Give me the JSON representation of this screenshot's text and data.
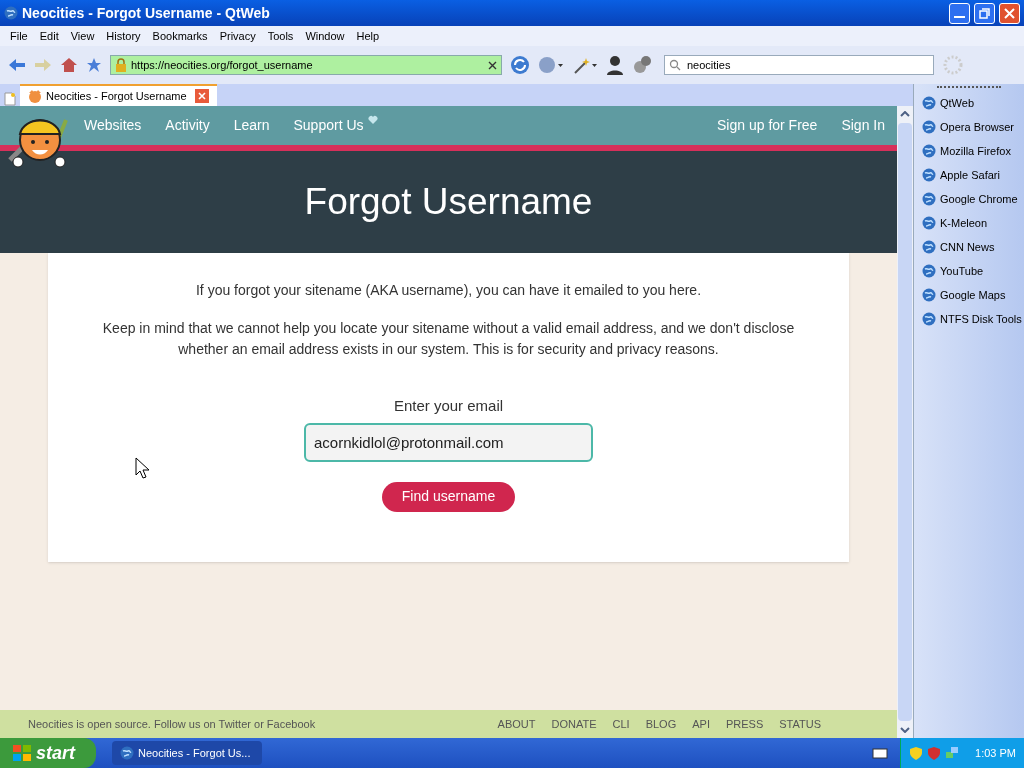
{
  "window": {
    "title": "Neocities - Forgot Username - QtWeb"
  },
  "menu": [
    "File",
    "Edit",
    "View",
    "History",
    "Bookmarks",
    "Privacy",
    "Tools",
    "Window",
    "Help"
  ],
  "address": {
    "value": "https://neocities.org/forgot_username"
  },
  "search": {
    "value": "neocities"
  },
  "tabs": [
    {
      "label": "Neocities - Forgot Username",
      "selected": true
    }
  ],
  "site_nav": {
    "links": [
      "Websites",
      "Activity",
      "Learn",
      "Support Us"
    ],
    "right_links": [
      "Sign up for Free",
      "Sign In"
    ]
  },
  "header": {
    "title": "Forgot Username"
  },
  "content": {
    "intro": "If you forgot your sitename (AKA username), you can have it emailed to you here.",
    "note": "Keep in mind that we cannot help you locate your sitename without a valid email address, and we don't disclose whether an email address exists in our system. This is for security and privacy reasons.",
    "email_label": "Enter your email",
    "email": {
      "value": "acornkidlol@protonmail.com"
    },
    "button": "Find username"
  },
  "footer": {
    "text": "Neocities is open source. Follow us on Twitter or Facebook",
    "links": [
      "ABOUT",
      "DONATE",
      "CLI",
      "BLOG",
      "API",
      "PRESS",
      "STATUS"
    ]
  },
  "bookmarks": [
    "QtWeb",
    "Opera Browser",
    "Mozilla Firefox",
    "Apple Safari",
    "Google Chrome",
    "K-Meleon",
    "CNN News",
    "YouTube",
    "Google Maps",
    "NTFS Disk Tools"
  ],
  "taskbar": {
    "start": "start",
    "tasks": [
      {
        "label": "Neocities - Forgot Us...",
        "selected": true
      }
    ],
    "clock": "1:03 PM"
  }
}
